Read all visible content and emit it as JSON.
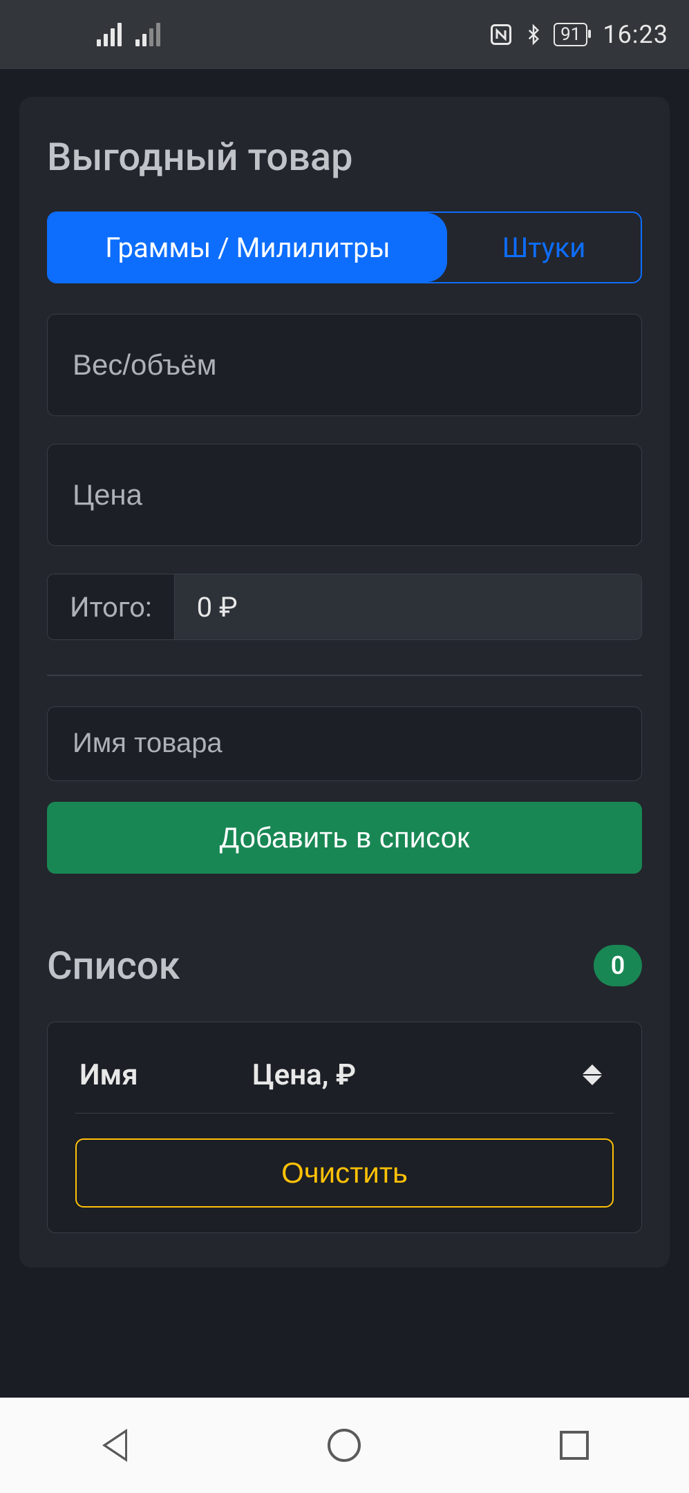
{
  "status": {
    "battery_text": "91",
    "time": "16:23"
  },
  "page": {
    "title": "Выгодный товар"
  },
  "segmented": {
    "active": "Граммы / Милилитры",
    "inactive": "Штуки"
  },
  "inputs": {
    "weight_placeholder": "Вес/объём",
    "price_placeholder": "Цена",
    "name_placeholder": "Имя товара"
  },
  "total": {
    "label": "Итого:",
    "value": "0 ₽"
  },
  "buttons": {
    "add": "Добавить в список",
    "clear": "Очистить"
  },
  "list": {
    "title": "Список",
    "count": "0",
    "columns": {
      "name": "Имя",
      "price": "Цена, ₽"
    }
  }
}
